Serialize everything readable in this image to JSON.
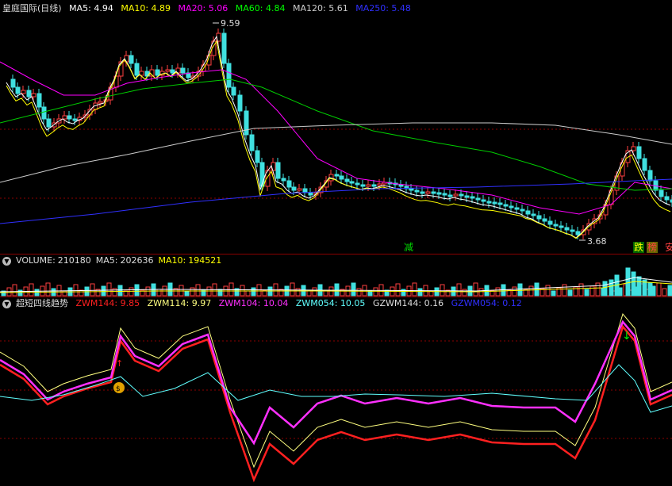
{
  "main_panel": {
    "title": "皇庭国际(日线)",
    "ma": [
      {
        "label": "MA5:",
        "value": "4.94",
        "color": "#ffffff"
      },
      {
        "label": "MA10:",
        "value": "4.89",
        "color": "#ffff00"
      },
      {
        "label": "MA20:",
        "value": "5.06",
        "color": "#ff00ff"
      },
      {
        "label": "MA60:",
        "value": "4.84",
        "color": "#00ff00"
      },
      {
        "label": "MA120:",
        "value": "5.61",
        "color": "#cccccc"
      },
      {
        "label": "MA250:",
        "value": "5.48",
        "color": "#3030ff"
      }
    ],
    "high_label": "9.59",
    "low_label": "3.68",
    "signals": [
      "减",
      "跌",
      "榜",
      "安"
    ]
  },
  "volume_panel": {
    "title": "VOLUME:",
    "volume": "210180",
    "ma5_label": "MA5:",
    "ma5": "202636",
    "ma10_label": "MA10:",
    "ma10": "194521"
  },
  "indicator_panel": {
    "title": "超短四线趋势",
    "lines": [
      {
        "label": "ZWM144:",
        "value": "9.85",
        "color": "#ff2020"
      },
      {
        "label": "ZWM114:",
        "value": "9.97",
        "color": "#ffff80"
      },
      {
        "label": "ZWM104:",
        "value": "10.04",
        "color": "#ff30ff"
      },
      {
        "label": "ZWM054:",
        "value": "10.05",
        "color": "#60ffff"
      },
      {
        "label": "GZWM144:",
        "value": "0.16",
        "color": "#dddddd"
      },
      {
        "label": "GZWM054:",
        "value": "0.12",
        "color": "#3030ff"
      }
    ]
  }
}
